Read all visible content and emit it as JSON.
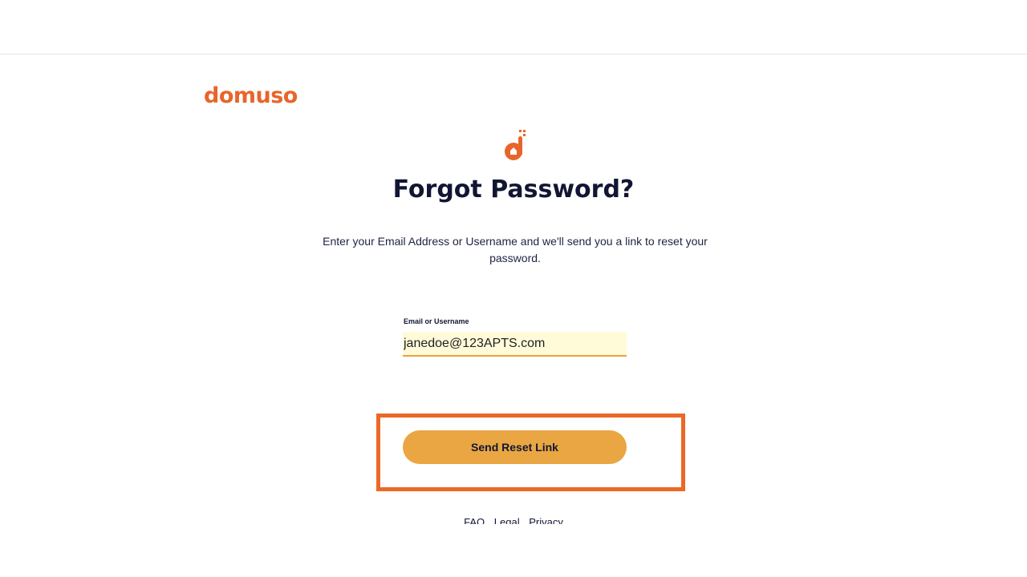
{
  "brand": {
    "name": "domuso",
    "color": "#e8652a"
  },
  "page": {
    "title": "Forgot Password?",
    "instructions": "Enter your Email Address or Username and we'll send you a link to reset your password."
  },
  "form": {
    "email_label": "Email or Username",
    "email_value": "janedoe@123APTS.com",
    "submit_label": "Send Reset Link",
    "input_background": "#fffbd9",
    "button_color": "#e9a642"
  },
  "footer": {
    "links": [
      "FAQ",
      "Legal",
      "Privacy"
    ]
  },
  "highlight": {
    "color": "#ea6a25",
    "target": "Send Reset Link"
  }
}
